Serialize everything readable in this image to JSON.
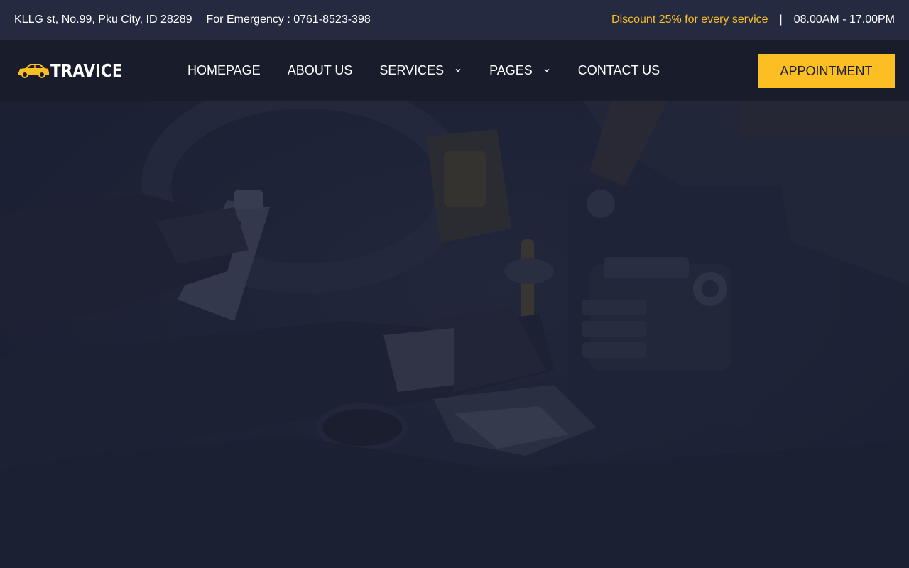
{
  "topbar": {
    "address": "KLLG st, No.99, Pku City, ID 28289",
    "emergency": "For Emergency : 0761-8523-398",
    "discount": "Discount 25% for every service",
    "separator": "|",
    "hours": "08.00AM - 17.00PM"
  },
  "navbar": {
    "logo_text": "TRAVICE",
    "logo_icon": "car-icon",
    "menu": [
      {
        "label": "HOMEPAGE",
        "has_dropdown": false
      },
      {
        "label": "ABOUT US",
        "has_dropdown": false
      },
      {
        "label": "SERVICES",
        "has_dropdown": true
      },
      {
        "label": "PAGES",
        "has_dropdown": true
      },
      {
        "label": "CONTACT US",
        "has_dropdown": false
      }
    ],
    "cta_label": "APPOINTMENT"
  },
  "colors": {
    "accent": "#fbbf24",
    "topbar_bg": "#242a40",
    "navbar_bg": "#191d2b",
    "hero_bg": "#1d2236"
  }
}
